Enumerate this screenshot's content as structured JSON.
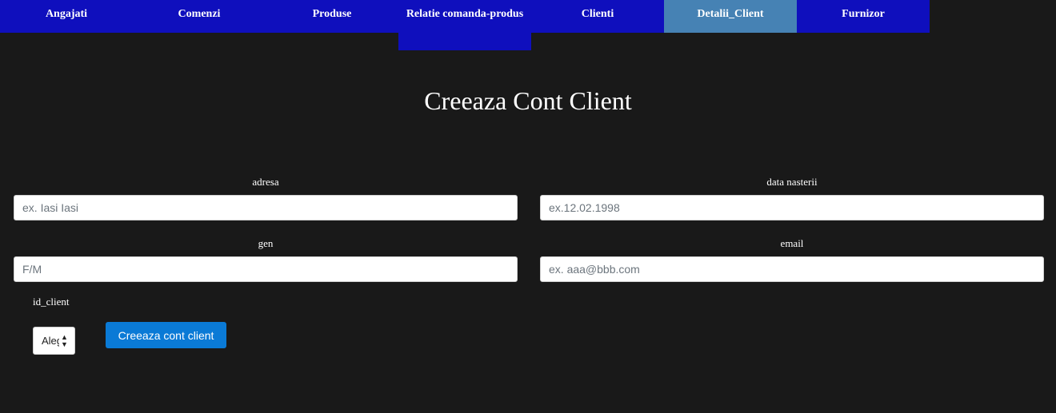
{
  "nav": {
    "items": [
      {
        "label": "Angajati"
      },
      {
        "label": "Comenzi"
      },
      {
        "label": "Produse"
      },
      {
        "label": "Relatie comanda-produs"
      },
      {
        "label": "Clienti"
      },
      {
        "label": "Detalii_Client",
        "active": true
      },
      {
        "label": "Furnizor"
      }
    ]
  },
  "page": {
    "title": "Creeaza Cont Client"
  },
  "form": {
    "adresa": {
      "label": "adresa",
      "placeholder": "ex. Iasi Iasi",
      "value": ""
    },
    "data_nasterii": {
      "label": "data nasterii",
      "placeholder": "ex.12.02.1998",
      "value": ""
    },
    "gen": {
      "label": "gen",
      "placeholder": "F/M",
      "value": ""
    },
    "email": {
      "label": "email",
      "placeholder": "ex. aaa@bbb.com",
      "value": ""
    },
    "id_client": {
      "label": "id_client",
      "selected": "Alege"
    },
    "submit_label": "Creeaza cont client"
  },
  "colors": {
    "background": "#191919",
    "nav": "#0f0fbd",
    "nav_active": "#4682b4",
    "button": "#0a7ad6"
  }
}
